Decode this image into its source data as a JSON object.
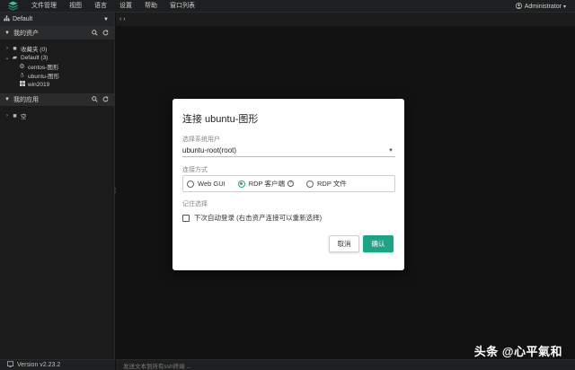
{
  "topbar": {
    "menu": [
      "文件管理",
      "视图",
      "语言",
      "设置",
      "帮助",
      "窗口列表"
    ],
    "user": "Administrator",
    "user_caret": "▾"
  },
  "sidebar": {
    "workspace": "Default",
    "assets_title": "我的资产",
    "tree": [
      {
        "label": "收藏夹 (0)",
        "icon": "folder-icon",
        "level": 1,
        "arrow": "›"
      },
      {
        "label": "Default (3)",
        "icon": "folder-open-icon",
        "level": 1,
        "arrow": "⌄"
      },
      {
        "label": "centos-图形",
        "icon": "settings-icon",
        "level": 2,
        "arrow": ""
      },
      {
        "label": "ubuntu-图形",
        "icon": "linux-icon",
        "level": 2,
        "arrow": ""
      },
      {
        "label": "win2019",
        "icon": "windows-icon",
        "level": 2,
        "arrow": ""
      }
    ],
    "apps_title": "我的应用",
    "apps_tree": [
      {
        "label": "空",
        "icon": "folder-icon",
        "level": 1,
        "arrow": "›"
      }
    ],
    "version": "Version v2.23.2"
  },
  "main": {
    "tab_arrows": "‹ ›",
    "command_bar": "发送文本到所有ssh终端 ..."
  },
  "watermark": "头条 @心平氣和",
  "modal": {
    "title": "连接 ubuntu-图形",
    "system_user_label": "选择系统用户",
    "system_user_value": "ubuntu-root(root)",
    "connect_method_label": "连接方式",
    "methods": [
      "Web GUI",
      "RDP 客户端",
      "RDP 文件"
    ],
    "selected_method": 1,
    "remember_label": "记住选择",
    "auto_login_label": "下次自动登录 (右击资产连接可以重新选择)",
    "cancel": "取消",
    "confirm": "确认"
  },
  "colors": {
    "accent": "#1fa387",
    "bg": "#121212",
    "sidebar": "#1b1b1b"
  }
}
